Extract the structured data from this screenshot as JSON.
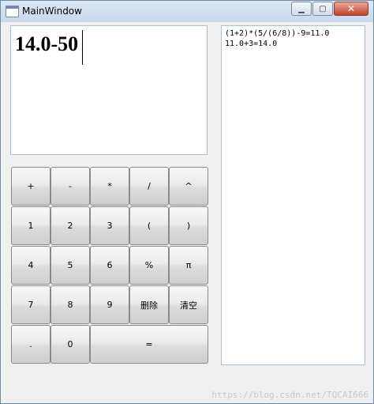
{
  "window": {
    "title": "MainWindow"
  },
  "display": {
    "expression": "14.0-50"
  },
  "history": {
    "lines": [
      "(1+2)*(5/(6/8))-9=11.0",
      "11.0+3=14.0"
    ]
  },
  "keypad": {
    "rows": [
      [
        "+",
        "-",
        "*",
        "/",
        "^"
      ],
      [
        "1",
        "2",
        "3",
        "(",
        ")"
      ],
      [
        "4",
        "5",
        "6",
        "%",
        "π"
      ],
      [
        "7",
        "8",
        "9",
        "删除",
        "清空"
      ],
      [
        ".",
        "0",
        "="
      ]
    ]
  },
  "watermark": "https://blog.csdn.net/TQCAI666"
}
